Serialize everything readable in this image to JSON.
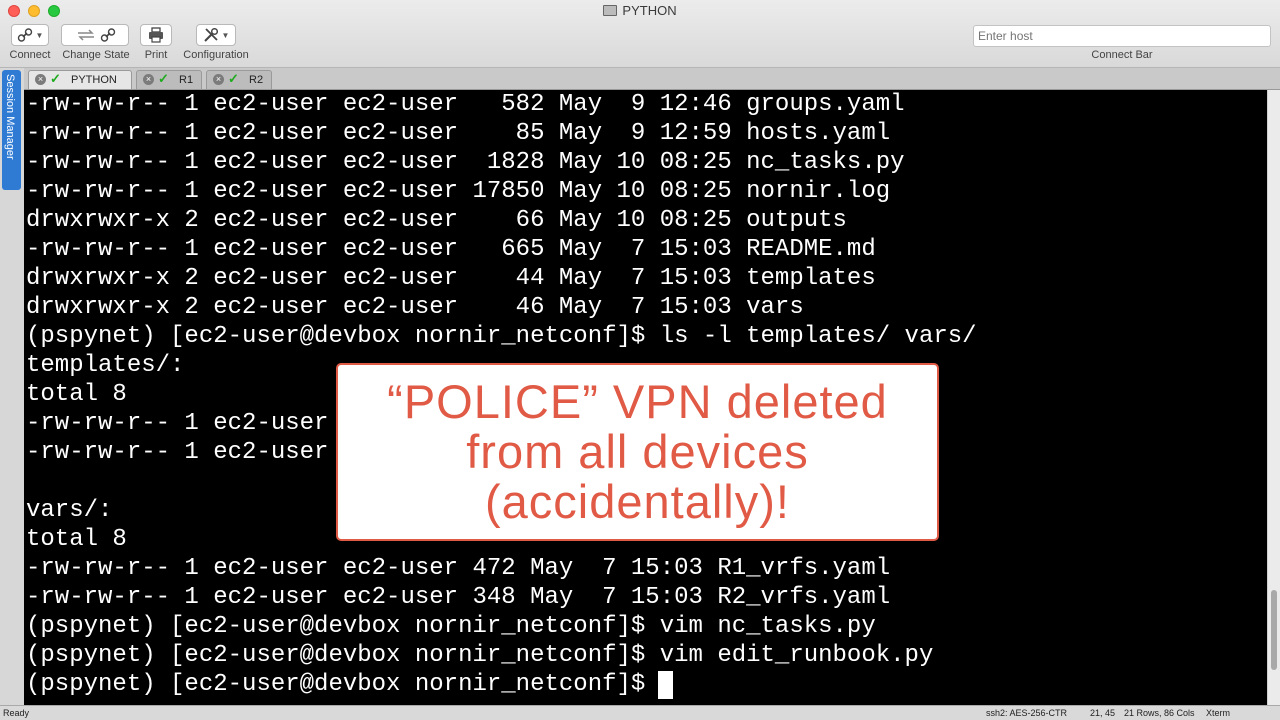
{
  "window": {
    "title": "PYTHON"
  },
  "toolbar": {
    "connect": "Connect",
    "change_state": "Change State",
    "print": "Print",
    "configuration": "Configuration",
    "host_placeholder": "Enter host",
    "connect_bar": "Connect Bar"
  },
  "tabs": [
    {
      "label": "PYTHON",
      "active": true
    },
    {
      "label": "R1",
      "active": false
    },
    {
      "label": "R2",
      "active": false
    }
  ],
  "sidebar": {
    "session_manager": "Session Manager"
  },
  "terminal": {
    "lines": [
      "-rw-rw-r-- 1 ec2-user ec2-user   582 May  9 12:46 groups.yaml",
      "-rw-rw-r-- 1 ec2-user ec2-user    85 May  9 12:59 hosts.yaml",
      "-rw-rw-r-- 1 ec2-user ec2-user  1828 May 10 08:25 nc_tasks.py",
      "-rw-rw-r-- 1 ec2-user ec2-user 17850 May 10 08:25 nornir.log",
      "drwxrwxr-x 2 ec2-user ec2-user    66 May 10 08:25 outputs",
      "-rw-rw-r-- 1 ec2-user ec2-user   665 May  7 15:03 README.md",
      "drwxrwxr-x 2 ec2-user ec2-user    44 May  7 15:03 templates",
      "drwxrwxr-x 2 ec2-user ec2-user    46 May  7 15:03 vars",
      "(pspynet) [ec2-user@devbox nornir_netconf]$ ls -l templates/ vars/",
      "templates/:",
      "total 8",
      "-rw-rw-r-- 1 ec2-user",
      "-rw-rw-r-- 1 ec2-user",
      "",
      "vars/:",
      "total 8",
      "-rw-rw-r-- 1 ec2-user ec2-user 472 May  7 15:03 R1_vrfs.yaml",
      "-rw-rw-r-- 1 ec2-user ec2-user 348 May  7 15:03 R2_vrfs.yaml",
      "(pspynet) [ec2-user@devbox nornir_netconf]$ vim nc_tasks.py",
      "(pspynet) [ec2-user@devbox nornir_netconf]$ vim edit_runbook.py",
      "(pspynet) [ec2-user@devbox nornir_netconf]$ "
    ]
  },
  "callout": {
    "line1": "“POLICE” VPN deleted",
    "line2": "from all devices",
    "line3": "(accidentally)!"
  },
  "status": {
    "ready": "Ready",
    "cipher": "ssh2: AES-256-CTR",
    "cursor_pos": "21, 45",
    "size": "21 Rows, 86 Cols",
    "term": "Xterm"
  },
  "colors": {
    "accent_callout": "#e05a45",
    "session_manager_blue": "#2f7bd4",
    "connected_check": "#1faa1f"
  }
}
